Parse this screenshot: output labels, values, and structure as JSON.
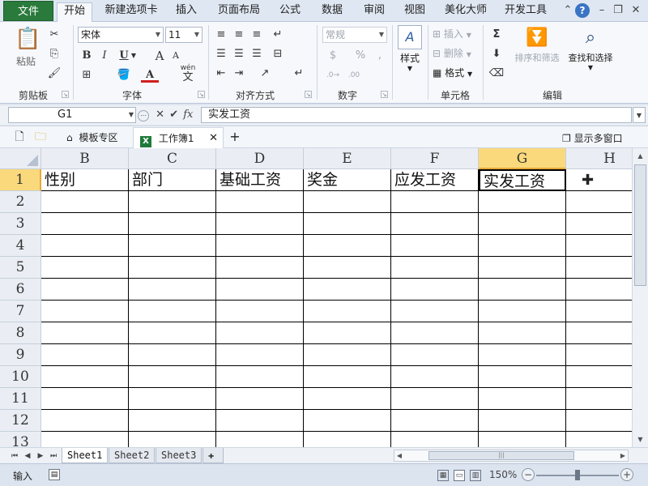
{
  "menu": {
    "file": "文件",
    "tabs": [
      "开始",
      "新建选项卡",
      "插入",
      "页面布局",
      "公式",
      "数据",
      "审阅",
      "视图",
      "美化大师",
      "开发工具"
    ],
    "active_tab": "开始"
  },
  "ribbon": {
    "clipboard": {
      "paste": "粘贴",
      "label": "剪贴板"
    },
    "font": {
      "name": "宋体",
      "size": "11",
      "bold": "B",
      "italic": "I",
      "underline": "U",
      "grow": "A",
      "shrink": "A",
      "color_letter": "A",
      "wen": "wén",
      "wen_char": "文",
      "label": "字体"
    },
    "alignment": {
      "label": "对齐方式"
    },
    "number": {
      "format": "常规",
      "percent": "%",
      "comma": ",",
      "label": "数字"
    },
    "styles": {
      "styles_button": "样式"
    },
    "cells": {
      "insert": "插入",
      "delete": "删除",
      "format": "格式",
      "label": "单元格"
    },
    "editing": {
      "sigma": "Σ",
      "sort": "排序和筛选",
      "find": "查找和选择",
      "label": "编辑"
    }
  },
  "formula_bar": {
    "name_box": "G1",
    "fx": "fx",
    "content": "实发工资"
  },
  "doc_tabs": {
    "template_zone": "模板专区",
    "workbook": "工作簿1",
    "xl_badge": "X",
    "add": "+",
    "multi_window": "显示多窗口"
  },
  "grid": {
    "columns": [
      "B",
      "C",
      "D",
      "E",
      "F",
      "G",
      "H"
    ],
    "selected_column": "G",
    "rows": [
      "1",
      "2",
      "3",
      "4",
      "5",
      "6",
      "7",
      "8",
      "9",
      "10",
      "11",
      "12",
      "13"
    ],
    "row1_values": [
      "性别",
      "部门",
      "基础工资",
      "奖金",
      "应发工资",
      "实发工资",
      ""
    ]
  },
  "sheets": {
    "tabs": [
      "Sheet1",
      "Sheet2",
      "Sheet3"
    ],
    "active": "Sheet1"
  },
  "status": {
    "mode": "输入",
    "zoom": "150%",
    "zoom_level_pct": 50
  }
}
